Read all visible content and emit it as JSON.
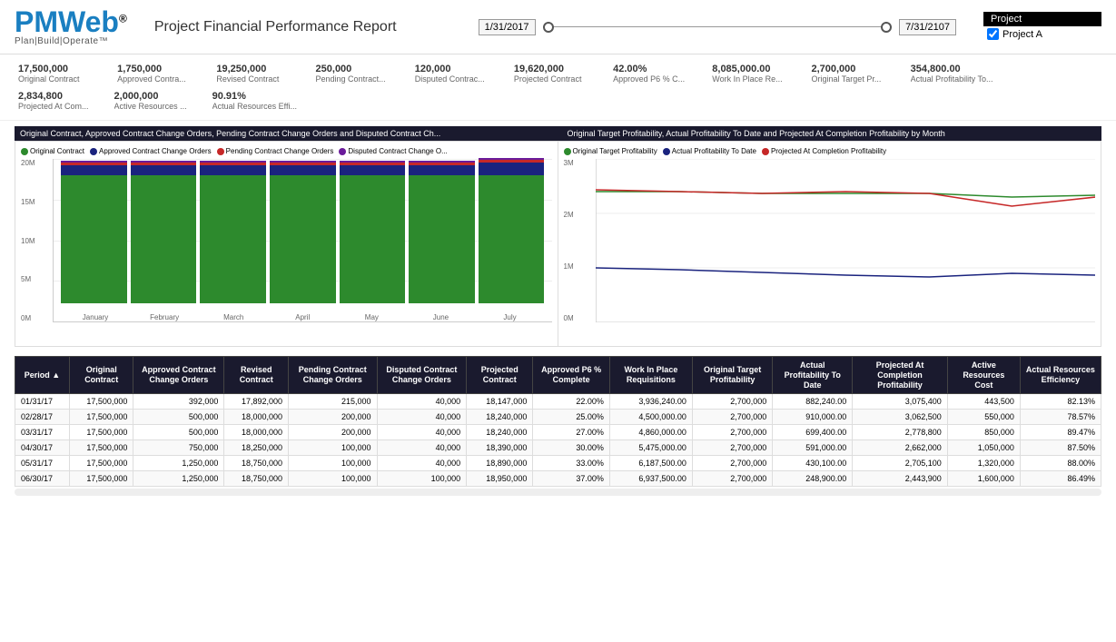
{
  "header": {
    "logo_main": "PMWeb",
    "logo_sub": "Plan|Build|Operate™",
    "report_title": "Project Financial Performance Report",
    "date_start": "1/31/2017",
    "date_end": "7/31/2107",
    "project_label": "Project",
    "project_option": "Project A"
  },
  "kpi": {
    "row1": [
      {
        "value": "17,500,000",
        "label": "Original Contract"
      },
      {
        "value": "1,750,000",
        "label": "Approved Contra..."
      },
      {
        "value": "19,250,000",
        "label": "Revised Contract"
      },
      {
        "value": "250,000",
        "label": "Pending Contract..."
      },
      {
        "value": "120,000",
        "label": "Disputed Contrac..."
      },
      {
        "value": "19,620,000",
        "label": "Projected Contract"
      },
      {
        "value": "42.00%",
        "label": "Approved P6 % C..."
      },
      {
        "value": "8,085,000.00",
        "label": "Work In Place Re..."
      },
      {
        "value": "2,700,000",
        "label": "Original Target Pr..."
      },
      {
        "value": "354,800.00",
        "label": "Actual Profitability To..."
      }
    ],
    "row2": [
      {
        "value": "2,834,800",
        "label": "Projected At Com..."
      },
      {
        "value": "2,000,000",
        "label": "Active Resources ..."
      },
      {
        "value": "90.91%",
        "label": "Actual Resources Effi..."
      }
    ]
  },
  "chart_left": {
    "header": "Original Contract, Approved Contract Change Orders, Pending Contract Change Orders and Disputed Contract Ch...",
    "legend": [
      {
        "label": "Original Contract",
        "color": "#2d8a2d"
      },
      {
        "label": "Approved Contract Change Orders",
        "color": "#1a237e"
      },
      {
        "label": "Pending Contract Change Orders",
        "color": "#c62828"
      },
      {
        "label": "Disputed Contract Change O...",
        "color": "#6a1b9a"
      }
    ],
    "y_labels": [
      "20M",
      "15M",
      "10M",
      "5M",
      "0M"
    ],
    "months": [
      "January",
      "February",
      "March",
      "April",
      "May",
      "June",
      "July"
    ],
    "bars": [
      {
        "original": 88,
        "approved": 7,
        "pending": 2,
        "disputed": 1
      },
      {
        "original": 88,
        "approved": 7,
        "pending": 2,
        "disputed": 1
      },
      {
        "original": 88,
        "approved": 7,
        "pending": 2,
        "disputed": 1
      },
      {
        "original": 88,
        "approved": 7,
        "pending": 2,
        "disputed": 1
      },
      {
        "original": 88,
        "approved": 7,
        "pending": 2,
        "disputed": 1
      },
      {
        "original": 88,
        "approved": 7,
        "pending": 2,
        "disputed": 1
      },
      {
        "original": 88,
        "approved": 9,
        "pending": 2,
        "disputed": 1
      }
    ]
  },
  "chart_right": {
    "header": "Original Target Profitability, Actual Profitability To Date and Projected At Completion Profitability by Month",
    "legend": [
      {
        "label": "Original Target Profitability",
        "color": "#2d8a2d"
      },
      {
        "label": "Actual Profitability To Date",
        "color": "#1a237e"
      },
      {
        "label": "Projected At Completion Profitability",
        "color": "#c62828"
      }
    ],
    "y_labels": [
      "3M",
      "2M",
      "1M",
      "0M"
    ]
  },
  "table": {
    "headers": [
      "Period ▲",
      "Original Contract",
      "Approved Contract Change Orders",
      "Revised Contract",
      "Pending Contract Change Orders",
      "Disputed Contract Change Orders",
      "Projected Contract",
      "Approved P6 % Complete",
      "Work In Place Requisitions",
      "Original Target Profitability",
      "Actual Profitability To Date",
      "Projected At Completion Profitability",
      "Active Resources Cost",
      "Actual Resources Efficiency"
    ],
    "rows": [
      [
        "01/31/17",
        "17,500,000",
        "392,000",
        "17,892,000",
        "215,000",
        "40,000",
        "18,147,000",
        "22.00%",
        "3,936,240.00",
        "2,700,000",
        "882,240.00",
        "3,075,400",
        "443,500",
        "82.13%"
      ],
      [
        "02/28/17",
        "17,500,000",
        "500,000",
        "18,000,000",
        "200,000",
        "40,000",
        "18,240,000",
        "25.00%",
        "4,500,000.00",
        "2,700,000",
        "910,000.00",
        "3,062,500",
        "550,000",
        "78.57%"
      ],
      [
        "03/31/17",
        "17,500,000",
        "500,000",
        "18,000,000",
        "200,000",
        "40,000",
        "18,240,000",
        "27.00%",
        "4,860,000.00",
        "2,700,000",
        "699,400.00",
        "2,778,800",
        "850,000",
        "89.47%"
      ],
      [
        "04/30/17",
        "17,500,000",
        "750,000",
        "18,250,000",
        "100,000",
        "40,000",
        "18,390,000",
        "30.00%",
        "5,475,000.00",
        "2,700,000",
        "591,000.00",
        "2,662,000",
        "1,050,000",
        "87.50%"
      ],
      [
        "05/31/17",
        "17,500,000",
        "1,250,000",
        "18,750,000",
        "100,000",
        "40,000",
        "18,890,000",
        "33.00%",
        "6,187,500.00",
        "2,700,000",
        "430,100.00",
        "2,705,100",
        "1,320,000",
        "88.00%"
      ],
      [
        "06/30/17",
        "17,500,000",
        "1,250,000",
        "18,750,000",
        "100,000",
        "100,000",
        "18,950,000",
        "37.00%",
        "6,937,500.00",
        "2,700,000",
        "248,900.00",
        "2,443,900",
        "1,600,000",
        "86.49%"
      ]
    ]
  }
}
